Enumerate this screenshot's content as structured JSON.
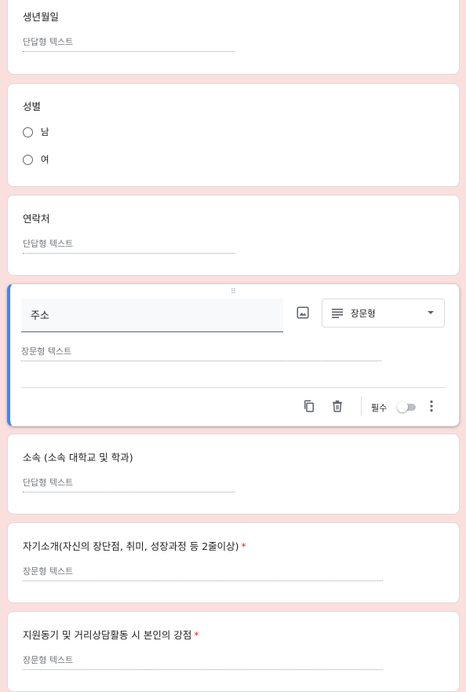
{
  "questions": [
    {
      "title": "생년월일",
      "hint": "단답형 텍스트"
    },
    {
      "title": "성별",
      "options": [
        "남",
        "여"
      ]
    },
    {
      "title": "연락처",
      "hint": "단답형 텍스트"
    },
    {
      "title": "주소",
      "hint": "장문형 텍스트",
      "type": "장문형",
      "required_label": "필수"
    },
    {
      "title": "소속 (소속 대학교 및 학과)",
      "hint": "단답형 텍스트"
    },
    {
      "title": "자기소개(자신의 장단점, 취미, 성장과정 등 2줄이상)",
      "hint": "장문형 텍스트",
      "required_mark": "*"
    },
    {
      "title": "지원동기 및 거리상담활동 시 본인의 강점",
      "hint": "장문형 텍스트",
      "required_mark": "*"
    }
  ],
  "colors": {
    "background": "#fbdfdc",
    "accent": "#4285f4",
    "required": "#d93025"
  },
  "icons": {
    "drag": "drag-handle-icon",
    "image": "image-icon",
    "type": "long-answer-icon",
    "dropdown": "dropdown-arrow-icon",
    "copy": "copy-icon",
    "delete": "trash-icon",
    "more": "more-vert-icon"
  }
}
